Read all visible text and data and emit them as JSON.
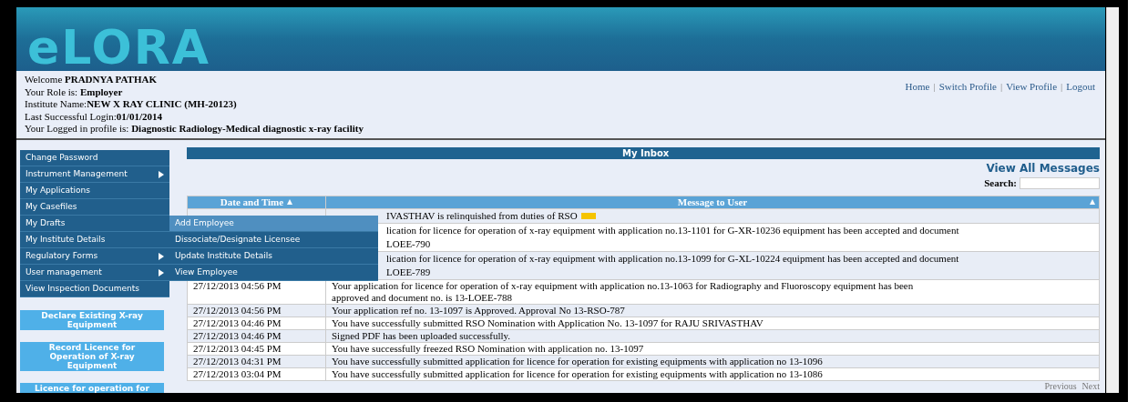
{
  "header": {
    "logo": "eLORA"
  },
  "user_info": [
    {
      "label": "Welcome ",
      "value": "PRADNYA PATHAK"
    },
    {
      "label": "Your Role is: ",
      "value": "Employer"
    },
    {
      "label": "Institute Name:",
      "value": "NEW X RAY CLINIC (MH-20123)"
    },
    {
      "label": "Last Successful Login:",
      "value": "01/01/2014"
    },
    {
      "label": "Your Logged in profile is: ",
      "value": "Diagnostic Radiology-Medical diagnostic x-ray facility"
    }
  ],
  "top_links": [
    "Home",
    "Switch Profile",
    "View Profile",
    "Logout"
  ],
  "top_links_separator": "|",
  "sidebar": {
    "items": [
      {
        "label": "Change Password",
        "has_submenu": false
      },
      {
        "label": "Instrument Management",
        "has_submenu": true
      },
      {
        "label": "My Applications",
        "has_submenu": false
      },
      {
        "label": "My Casefiles",
        "has_submenu": false
      },
      {
        "label": "My Drafts",
        "has_submenu": false
      },
      {
        "label": "My Institute Details",
        "has_submenu": false
      },
      {
        "label": "Regulatory Forms",
        "has_submenu": true
      },
      {
        "label": "User management",
        "has_submenu": true,
        "children": [
          {
            "label": "Add Employee",
            "selected": true
          },
          {
            "label": "Dissociate/Designate Licensee",
            "selected": false
          },
          {
            "label": "Update Institute Details",
            "selected": false
          },
          {
            "label": "View Employee",
            "selected": false
          }
        ]
      },
      {
        "label": "View Inspection Documents",
        "has_submenu": false
      }
    ],
    "buttons": [
      "Declare Existing X-ray Equipment",
      "Record Licence for Operation of X-ray Equipment",
      "Licence for operation for"
    ]
  },
  "inbox": {
    "title": "My Inbox",
    "view_all": "View All Messages",
    "search": {
      "label": "Search:"
    },
    "columns": [
      "Date and Time",
      "Message to User"
    ],
    "rows": [
      {
        "kind": "covered",
        "date": "",
        "lines": [
          "IVASTHAV is relinquished from duties of RSO"
        ],
        "flag": true
      },
      {
        "kind": "covered",
        "date": "",
        "lines": [
          "lication for licence for operation of x-ray equipment with application no.13-1101 for G-XR-10236 equipment has been accepted and document",
          "LOEE-790"
        ],
        "flag": false
      },
      {
        "kind": "covered",
        "date": "",
        "lines": [
          "lication for licence for operation of x-ray equipment with application no.13-1099 for G-XL-10224 equipment has been accepted and document",
          "LOEE-789"
        ],
        "flag": false
      },
      {
        "kind": "plain",
        "date": "27/12/2013 04:56 PM",
        "lines": [
          "Your application for licence for operation of x-ray equipment with application no.13-1063 for Radiography and Fluoroscopy equipment has been",
          "approved and document no. is 13-LOEE-788"
        ],
        "flag": false
      },
      {
        "kind": "plain",
        "date": "27/12/2013 04:56 PM",
        "lines": [
          "Your application ref no. 13-1097 is Approved. Approval No 13-RSO-787"
        ],
        "flag": false
      },
      {
        "kind": "plain",
        "date": "27/12/2013 04:46 PM",
        "lines": [
          "You have successfully submitted RSO Nomination with Application No. 13-1097 for RAJU SRIVASTHAV"
        ],
        "flag": false
      },
      {
        "kind": "plain",
        "date": "27/12/2013 04:46 PM",
        "lines": [
          "Signed PDF has been uploaded successfully."
        ],
        "flag": false
      },
      {
        "kind": "plain",
        "date": "27/12/2013 04:45 PM",
        "lines": [
          "You have successfully freezed RSO Nomination with application no. 13-1097"
        ],
        "flag": false
      },
      {
        "kind": "plain",
        "date": "27/12/2013 04:31 PM",
        "lines": [
          "You have successfully submitted application for licence for operation for existing equipments with application no 13-1096"
        ],
        "flag": false
      },
      {
        "kind": "plain",
        "date": "27/12/2013 03:04 PM",
        "lines": [
          "You have successfully submitted application for licence for operation for existing equipments with application no 13-1086"
        ],
        "flag": false
      }
    ],
    "pagination": [
      "Previous",
      "Next"
    ]
  }
}
